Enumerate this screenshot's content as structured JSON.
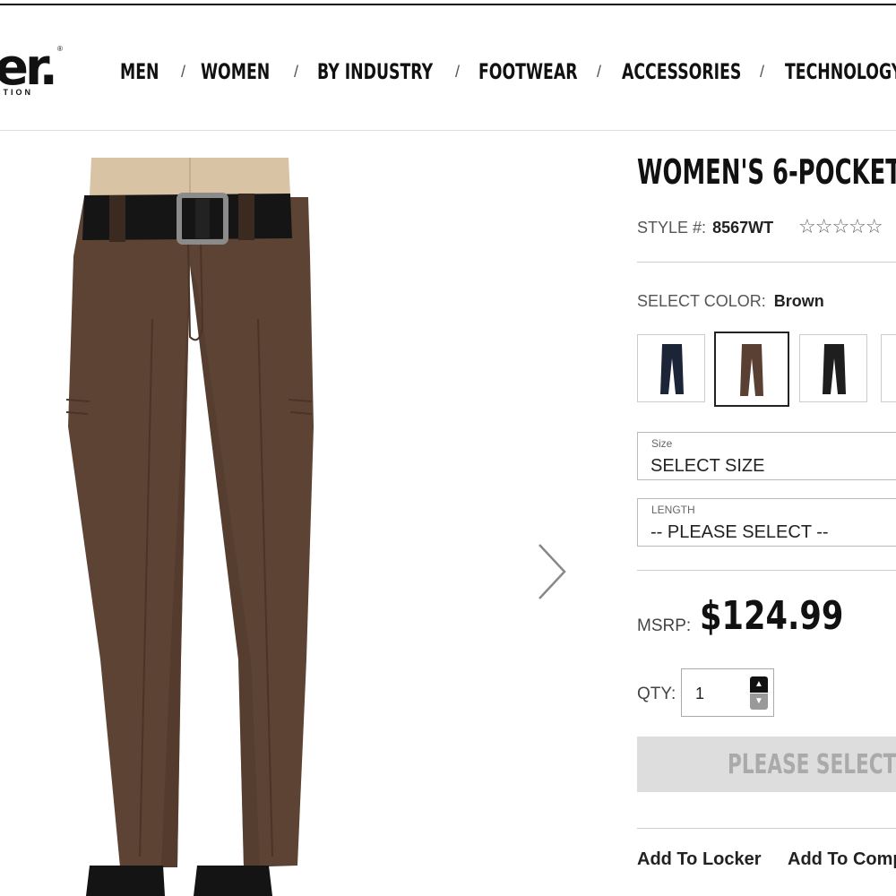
{
  "brand": {
    "logo_text": "er.",
    "logo_sub": "CTION"
  },
  "nav": {
    "items": [
      "MEN",
      "WOMEN",
      "BY INDUSTRY",
      "FOOTWEAR",
      "ACCESSORIES",
      "TECHNOLOGY"
    ],
    "separator": "/"
  },
  "product": {
    "title": "WOMEN'S 6-POCKET",
    "style_label": "STYLE #:",
    "style_number": "8567WT",
    "rating_stars": "☆☆☆☆☆",
    "color_label": "SELECT COLOR:",
    "selected_color": "Brown",
    "swatches": [
      {
        "color": "Navy",
        "hex": "#1c2438"
      },
      {
        "color": "Brown",
        "hex": "#5a4032"
      },
      {
        "color": "Black",
        "hex": "#1e1e1e"
      }
    ],
    "size": {
      "label": "Size",
      "value": "SELECT SIZE"
    },
    "length": {
      "label": "LENGTH",
      "value": "-- PLEASE SELECT --"
    },
    "msrp_label": "MSRP:",
    "price": "$124.99",
    "qty_label": "QTY:",
    "qty_value": "1",
    "cta_label": "PLEASE SELECT",
    "add_to_locker": "Add To Locker",
    "add_to_compare": "Add To Comp"
  },
  "colors": {
    "pants": "#5d4334",
    "shirt": "#d9c3a5",
    "belt": "#151515",
    "cta_bg": "#dddddd",
    "cta_text": "#aaaaaa"
  }
}
